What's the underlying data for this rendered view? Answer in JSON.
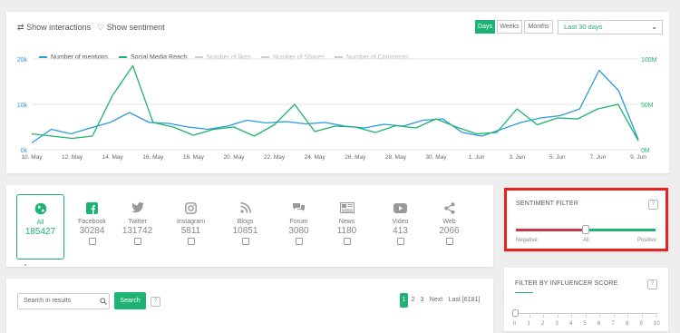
{
  "toolbar": {
    "show_interactions": "Show interactions",
    "show_sentiment": "Show sentiment",
    "periods": [
      "Days",
      "Weeks",
      "Months"
    ],
    "active_period": "Days",
    "date_range": "Last 30 days"
  },
  "colors": {
    "accent": "#1db374",
    "mentions": "#2a9be0",
    "reach": "#20b46a",
    "highlight": "#e8231b"
  },
  "chart_data": {
    "type": "line",
    "x_ticks": [
      "10. May",
      "12. May",
      "14. May",
      "16. May",
      "18. May",
      "20. May",
      "22. May",
      "24. May",
      "26. May",
      "28. May",
      "30. May",
      "1. Jun",
      "3. Jun",
      "5. Jun",
      "7. Jun",
      "9. Jun"
    ],
    "left_axis_ticks": [
      "20k",
      "10k",
      "0k"
    ],
    "right_axis_ticks": [
      "100M",
      "50M",
      "0M"
    ],
    "left_range": [
      0,
      20000
    ],
    "right_range": [
      0,
      100000000
    ],
    "legend": [
      "Number of mentions",
      "Social Media Reach",
      "Number of likes",
      "Number of Shares",
      "Number of Comments"
    ],
    "legend_enabled": [
      true,
      true,
      false,
      false,
      false
    ],
    "series": [
      {
        "name": "Number of mentions",
        "axis": "left",
        "color": "#2a9be0",
        "values": [
          1500,
          4500,
          3500,
          4800,
          6000,
          8200,
          6000,
          5800,
          5000,
          4500,
          5200,
          6500,
          5900,
          6200,
          5700,
          6000,
          5200,
          4800,
          5600,
          5200,
          6500,
          6800,
          3800,
          3000,
          4500,
          6000,
          7000,
          7500,
          9000,
          17500,
          13000,
          2200
        ]
      },
      {
        "name": "Social Media Reach",
        "axis": "left",
        "color": "#20b46a",
        "values": [
          3500,
          3000,
          2500,
          3000,
          12000,
          18500,
          6000,
          5000,
          3200,
          4500,
          5000,
          3000,
          5500,
          10000,
          4000,
          5200,
          5000,
          3800,
          5300,
          4800,
          6800,
          5000,
          3500,
          3800,
          9000,
          5500,
          7000,
          6800,
          9000,
          10000,
          2000
        ]
      }
    ]
  },
  "sources": [
    {
      "label": "All",
      "count": "185427",
      "icon": "globe-icon",
      "active": true
    },
    {
      "label": "Facebook",
      "count": "30284",
      "icon": "facebook-icon",
      "active": false
    },
    {
      "label": "Twitter",
      "count": "131742",
      "icon": "twitter-icon",
      "active": false
    },
    {
      "label": "Instagram",
      "count": "5811",
      "icon": "instagram-icon",
      "active": false
    },
    {
      "label": "Blogs",
      "count": "10851",
      "icon": "rss-icon",
      "active": false
    },
    {
      "label": "Forum",
      "count": "3080",
      "icon": "forum-icon",
      "active": false
    },
    {
      "label": "News",
      "count": "1180",
      "icon": "news-icon",
      "active": false
    },
    {
      "label": "Video",
      "count": "413",
      "icon": "video-icon",
      "active": false
    },
    {
      "label": "Web",
      "count": "2066",
      "icon": "share-icon",
      "active": false
    }
  ],
  "search": {
    "placeholder": "Search in results",
    "button": "Search",
    "help": "?"
  },
  "pagination": {
    "pages": [
      "1",
      "2",
      "3"
    ],
    "active": "1",
    "next": "Next",
    "last": "Last [6181]"
  },
  "sentiment_filter": {
    "title": "SENTIMENT FILTER",
    "help": "?",
    "labels": [
      "Negative",
      "All",
      "Positive"
    ],
    "value": 0.5
  },
  "influencer_filter": {
    "title": "FILTER BY INFLUENCER SCORE",
    "help": "?",
    "scale": [
      "0",
      "1",
      "2",
      "3",
      "4",
      "5",
      "6",
      "7",
      "8",
      "9",
      "10"
    ]
  }
}
